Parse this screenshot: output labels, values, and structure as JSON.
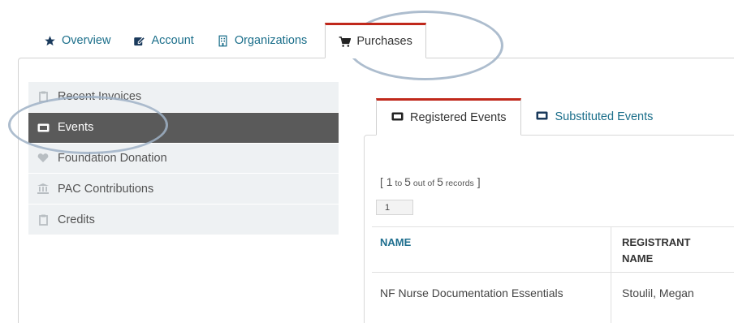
{
  "top_tabs": [
    {
      "label": "Overview",
      "icon": "star-icon"
    },
    {
      "label": "Account",
      "icon": "edit-icon"
    },
    {
      "label": "Organizations",
      "icon": "building-icon"
    },
    {
      "label": "Purchases",
      "icon": "cart-icon"
    }
  ],
  "side_menu": [
    {
      "label": "Recent Invoices",
      "icon": "clipboard-icon"
    },
    {
      "label": "Events",
      "icon": "ticket-icon"
    },
    {
      "label": "Foundation Donation",
      "icon": "heart-icon"
    },
    {
      "label": "PAC Contributions",
      "icon": "institution-icon"
    },
    {
      "label": "Credits",
      "icon": "clipboard-icon"
    }
  ],
  "inner_tabs": [
    {
      "label": "Registered Events",
      "icon": "ticket-icon"
    },
    {
      "label": "Substituted Events",
      "icon": "ticket-icon"
    }
  ],
  "records": {
    "open": "[ ",
    "from": "1",
    "to_word": " to ",
    "to": "5",
    "out_of": " out of ",
    "total": "5",
    "records_word": " records",
    "close": " ]"
  },
  "pagination": {
    "page": "1"
  },
  "table": {
    "columns": [
      "NAME",
      "REGISTRANT\nNAME"
    ],
    "rows": [
      {
        "name": "NF Nurse Documentation Essentials",
        "registrant": "Stoulil, Megan"
      }
    ]
  },
  "colors": {
    "accent": "#c0281b",
    "link": "#1a6e8a",
    "active_menu": "#5a5a5a"
  }
}
